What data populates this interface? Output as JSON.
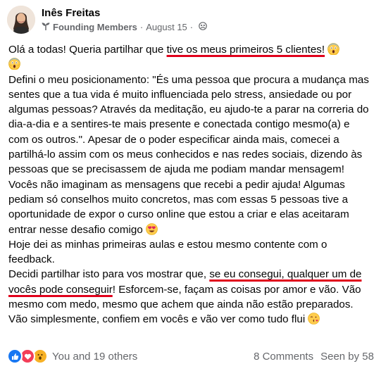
{
  "post": {
    "author": "Inês Freitas",
    "group": "Founding Members",
    "date": "August 15",
    "icons": {
      "avatar": "profile-photo",
      "group_icon": "sprout-icon",
      "audience_icon": "group-audience-icon"
    },
    "body": {
      "p1_a": "Olá a todas! Queria partilhar que ",
      "p1_hl": "tive os meus primeiros 5 clientes!",
      "p2": "Defini o meu posicionamento: \"És uma pessoa que procura a mudança mas sentes que a tua vida é muito influenciada pelo stress, ansiedade ou por algumas pessoas? Através da meditação, eu ajudo-te a parar na correria do dia-a-dia e a sentires-te mais presente e conectada contigo mesmo(a) e com os outros.\". Apesar de o poder especificar ainda mais, comecei a partilhá-lo assim com os meus conhecidos e nas redes sociais, dizendo às pessoas que se precisassem de ajuda me podiam mandar mensagem! Vocês não imaginam as mensagens que recebi a pedir ajuda! Algumas pediam só conselhos muito concretos, mas com essas 5 pessoas tive a oportunidade de expor o curso online que estou a criar e elas aceitaram entrar nesse desafio comigo ",
      "p3": "Hoje dei as minhas primeiras aulas e estou mesmo contente com o feedback.",
      "p4_a": "Decidi partilhar isto para vos mostrar que, ",
      "p4_hl": "se eu consegui, qualquer um de vocês pode conseguir",
      "p4_b": "! Esforcem-se, façam as coisas por amor e vão. Vão mesmo com medo, mesmo que achem que ainda não estão preparados. Vão simplesmente, confiem em vocês e vão ver como tudo flui "
    },
    "emojis": {
      "shocked_1": "face-screaming-in-fear-emoji",
      "shocked_2": "face-screaming-in-fear-emoji",
      "heart_eyes": "smiling-face-with-heart-eyes-emoji",
      "kiss": "face-blowing-a-kiss-emoji"
    },
    "footer": {
      "reactions_label": "You and 19 others",
      "comments": "8 Comments",
      "seen": "Seen by 58",
      "reaction_types": [
        "like",
        "love",
        "wow"
      ]
    }
  },
  "colors": {
    "underline_highlight": "#e0001b",
    "like": "#1877f2",
    "love": "#f33e58",
    "wow": "#f7b125",
    "secondary_text": "#65676b"
  }
}
